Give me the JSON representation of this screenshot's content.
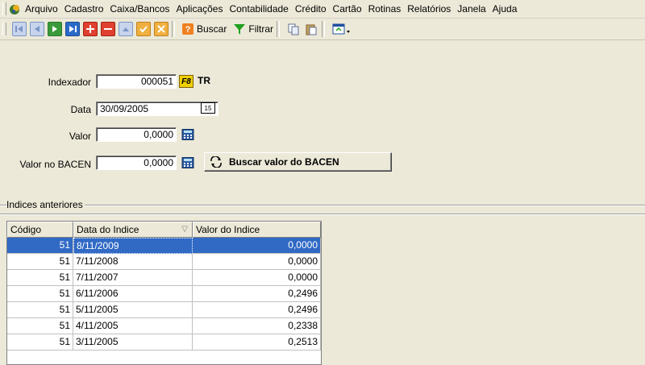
{
  "menu": {
    "items": [
      "Arquivo",
      "Cadastro",
      "Caixa/Bancos",
      "Aplicações",
      "Contabilidade",
      "Crédito",
      "Cartão",
      "Rotinas",
      "Relatórios",
      "Janela",
      "Ajuda"
    ]
  },
  "toolbar": {
    "search_label": "Buscar",
    "filter_label": "Filtrar"
  },
  "form": {
    "indexador_label": "Indexador",
    "indexador_value": "000051",
    "f8_label": "F8",
    "indexador_name": "TR",
    "data_label": "Data",
    "data_value": "30/09/2005",
    "calendar_icon_text": "15",
    "valor_label": "Valor",
    "valor_value": "0,0000",
    "valor_bacen_label": "Valor no BACEN",
    "valor_bacen_value": "0,0000",
    "bacen_button_label": "Buscar valor do BACEN"
  },
  "group": {
    "title": "Indices anteriores"
  },
  "grid": {
    "columns": [
      "Código",
      "Data do Indice",
      "Valor do Indice"
    ],
    "sort_indicator": "▽",
    "rows": [
      {
        "codigo": "51",
        "data": "8/11/2009",
        "valor": "0,0000"
      },
      {
        "codigo": "51",
        "data": "7/11/2008",
        "valor": "0,0000"
      },
      {
        "codigo": "51",
        "data": "7/11/2007",
        "valor": "0,0000"
      },
      {
        "codigo": "51",
        "data": "6/11/2006",
        "valor": "0,2496"
      },
      {
        "codigo": "51",
        "data": "5/11/2005",
        "valor": "0,2496"
      },
      {
        "codigo": "51",
        "data": "4/11/2005",
        "valor": "0,2338"
      },
      {
        "codigo": "51",
        "data": "3/11/2005",
        "valor": "0,2513"
      }
    ]
  },
  "colors": {
    "window_bg": "#ece9d8",
    "selection": "#316ac5",
    "f8_bg": "#f0d000"
  }
}
